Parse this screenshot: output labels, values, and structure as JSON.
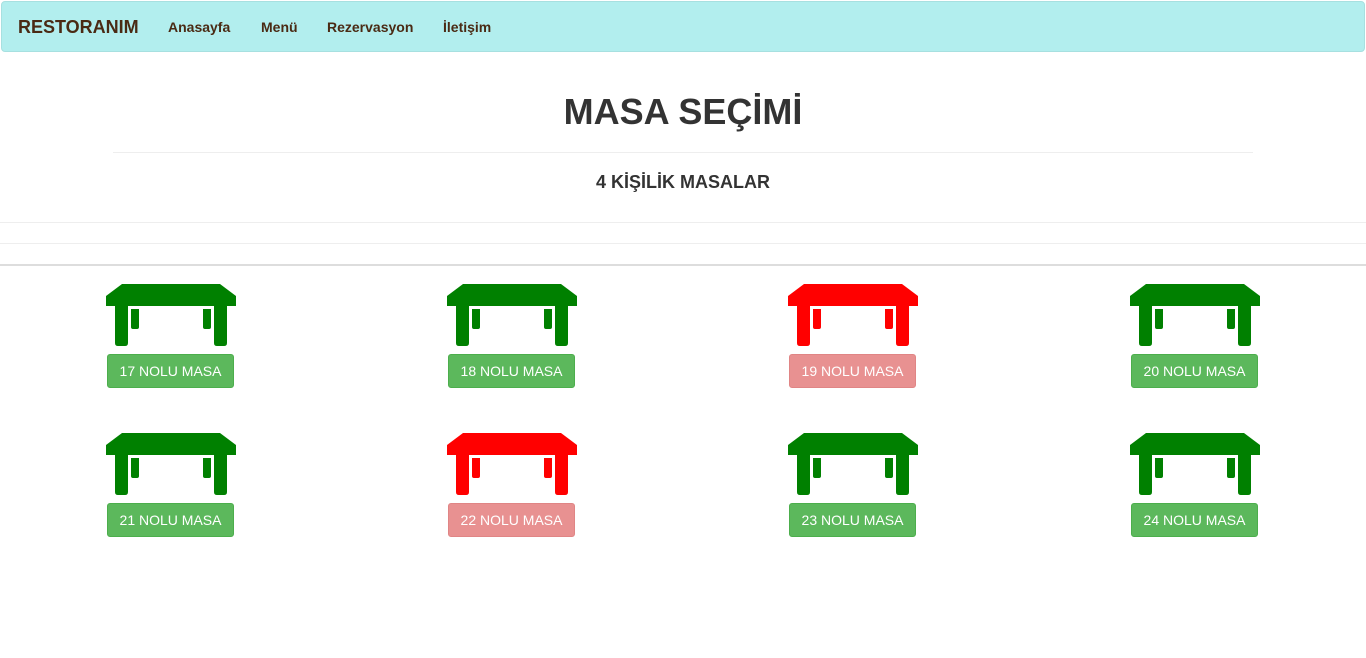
{
  "navbar": {
    "brand": "RESTORANIM",
    "links": [
      "Anasayfa",
      "Menü",
      "Rezervasyon",
      "İletişim"
    ]
  },
  "page": {
    "title": "MASA SEÇİMİ",
    "subtitle": "4 KİŞİLİK MASALAR"
  },
  "colors": {
    "available": "#008000",
    "occupied": "#ff0000",
    "available_button": "#5cb85c",
    "occupied_button": "#e89191"
  },
  "tables": [
    {
      "label": "17 NOLU MASA",
      "status": "available",
      "icon": "table-icon"
    },
    {
      "label": "18 NOLU MASA",
      "status": "available",
      "icon": "table-icon"
    },
    {
      "label": "19 NOLU MASA",
      "status": "occupied",
      "icon": "table-icon"
    },
    {
      "label": "20 NOLU MASA",
      "status": "available",
      "icon": "table-icon"
    },
    {
      "label": "21 NOLU MASA",
      "status": "available",
      "icon": "table-icon"
    },
    {
      "label": "22 NOLU MASA",
      "status": "occupied",
      "icon": "table-icon"
    },
    {
      "label": "23 NOLU MASA",
      "status": "available",
      "icon": "table-icon"
    },
    {
      "label": "24 NOLU MASA",
      "status": "available",
      "icon": "table-icon"
    }
  ]
}
